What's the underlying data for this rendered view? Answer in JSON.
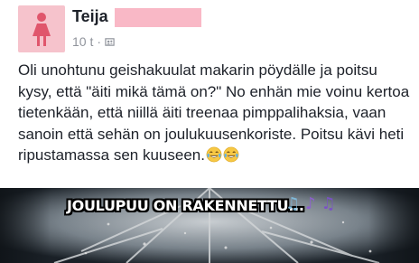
{
  "post": {
    "author": {
      "name": "Teija"
    },
    "meta": {
      "time": "10 t",
      "separator": "·",
      "audience_icon": "friends-icon"
    },
    "text": "Oli unohtunu geishakuulat makarin pöydälle ja poitsu kysy, että \"äiti mikä tämä on?\" No enhän mie voinu kertoa tietenkään, että niillä äiti treenaa pimppalihaksia, vaan sanoin että sehän on joulukuusenkoriste. Poitsu kävi heti ripustamassa sen kuuseen.",
    "emojis": [
      "face-with-tears-of-joy",
      "face-with-tears-of-joy"
    ],
    "image": {
      "caption": "JOULUPUU ON RAKENNETTU...",
      "notes": [
        "♫",
        "♪",
        "♫"
      ]
    }
  },
  "colors": {
    "avatar_bg": "#f6c3cc",
    "avatar_icon": "#e0566c",
    "redaction": "#f9b8c6",
    "meta_text": "#90949c"
  }
}
